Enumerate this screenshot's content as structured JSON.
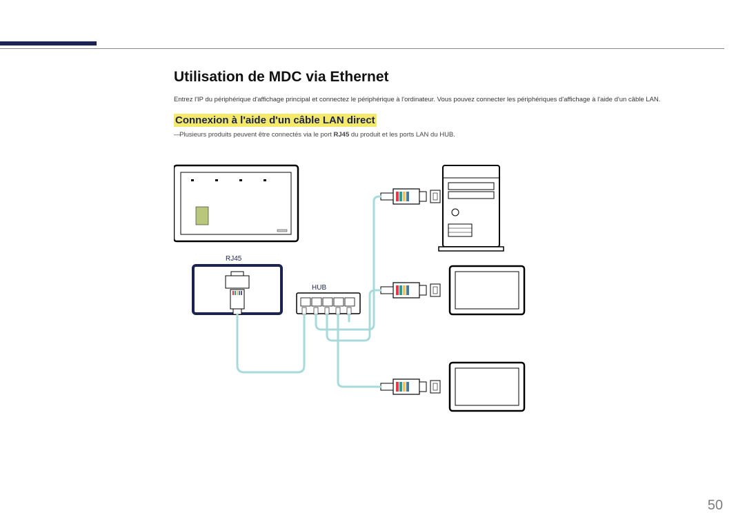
{
  "heading": "Utilisation de MDC via Ethernet",
  "intro": "Entrez l'IP du périphérique d'affichage principal et connectez le périphérique à l'ordinateur. Vous pouvez connecter les périphériques d'affichage à l'aide d'un câble LAN.",
  "subheading": "Connexion à l'aide d'un câble LAN direct",
  "note_prefix": "Plusieurs produits peuvent être connectés via le port ",
  "note_bold": "RJ45",
  "note_suffix": " du produit et les ports LAN du HUB.",
  "labels": {
    "rj45": "RJ45",
    "hub": "HUB"
  },
  "page_number": "50"
}
